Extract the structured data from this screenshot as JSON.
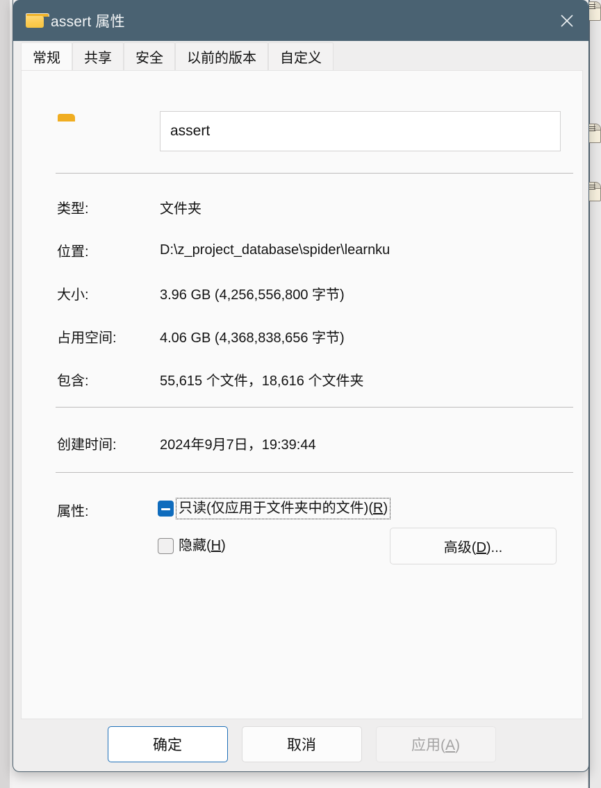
{
  "window": {
    "title": "assert 属性",
    "folder_icon": "folder-icon",
    "close_label": "×"
  },
  "tabs": [
    {
      "label": "常规",
      "active": true
    },
    {
      "label": "共享",
      "active": false
    },
    {
      "label": "安全",
      "active": false
    },
    {
      "label": "以前的版本",
      "active": false
    },
    {
      "label": "自定义",
      "active": false
    }
  ],
  "general": {
    "folder_icon": "folder-icon-large",
    "name_value": "assert",
    "name_placeholder": "",
    "rows": [
      {
        "label": "类型:",
        "value": "文件夹"
      },
      {
        "label": "位置:",
        "value": "D:\\z_project_database\\spider\\learnku"
      },
      {
        "label": "大小:",
        "value": "3.96 GB (4,256,556,800 字节)"
      },
      {
        "label": "占用空间:",
        "value": "4.06 GB (4,368,838,656 字节)"
      },
      {
        "label": "包含:",
        "value": "55,615 个文件，18,616 个文件夹"
      },
      {
        "label": "创建时间:",
        "value": "2024年9月7日，19:39:44"
      }
    ],
    "attributes": {
      "label": "属性:",
      "readonly": {
        "text_main": "只读(仅应用于文件夹中的文件)(",
        "accel": "R",
        "text_tail": ")",
        "state": "indeterminate",
        "focused": true
      },
      "hidden": {
        "text_main": "隐藏(",
        "accel": "H",
        "text_tail": ")",
        "state": "unchecked",
        "focused": false
      },
      "advanced_button": {
        "text_main": "高级(",
        "accel": "D",
        "text_tail": ")..."
      }
    }
  },
  "footer": {
    "ok_label": "确定",
    "cancel_label": "取消",
    "apply_main": "应用(",
    "apply_accel": "A",
    "apply_tail": ")"
  },
  "colors": {
    "titlebar": "#4a6272",
    "accent": "#0f6cbd",
    "default_button_border": "#1d6fb8",
    "folder_yellow": "#fbcb52",
    "dialog_bg": "#efeeee",
    "card_bg": "#fafafa"
  }
}
